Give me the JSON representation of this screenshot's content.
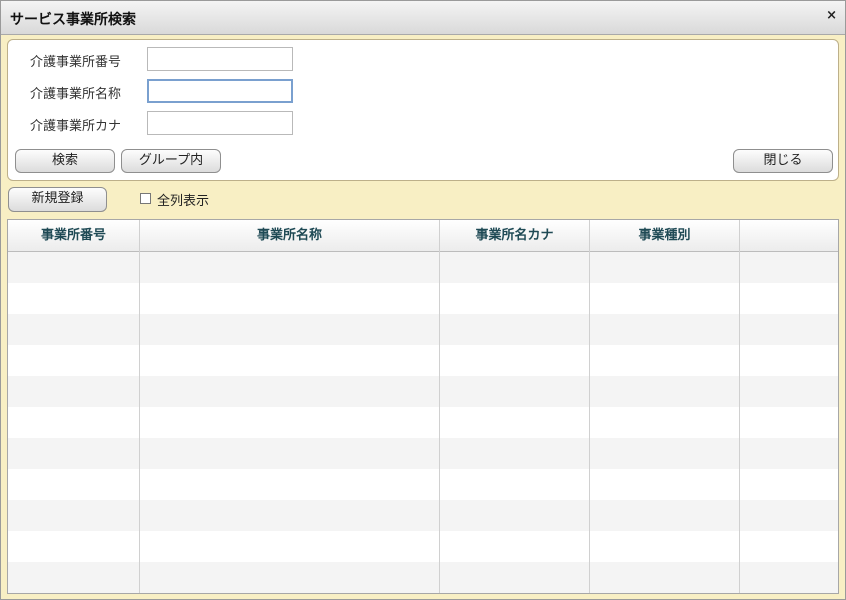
{
  "window": {
    "title": "サービス事業所検索",
    "close_symbol": "×"
  },
  "form": {
    "fields": [
      {
        "label": "介護事業所番号",
        "value": ""
      },
      {
        "label": "介護事業所名称",
        "value": ""
      },
      {
        "label": "介護事業所カナ",
        "value": ""
      }
    ],
    "buttons": {
      "search": "検索",
      "group": "グループ内",
      "close": "閉じる"
    }
  },
  "toolbar": {
    "new_register": "新規登録",
    "show_all_columns_label": "全列表示",
    "show_all_columns_checked": false
  },
  "table": {
    "columns": [
      "事業所番号",
      "事業所名称",
      "事業所名カナ",
      "事業種別",
      ""
    ],
    "rows": []
  },
  "colors": {
    "window_bg": "#f8efc4",
    "header_text": "#1f4a55"
  }
}
